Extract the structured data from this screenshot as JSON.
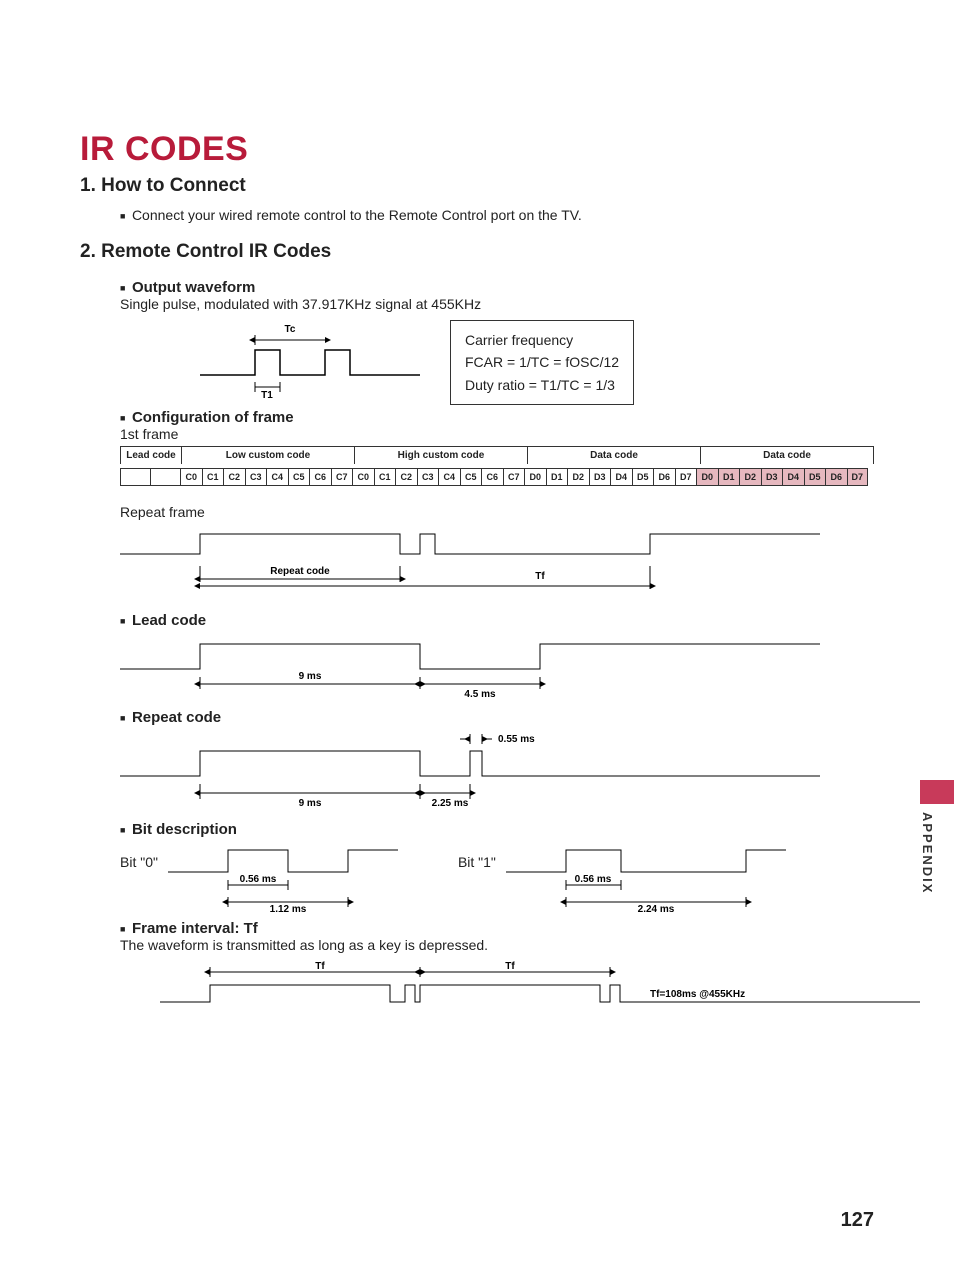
{
  "title": "IR CODES",
  "sections": {
    "connect": {
      "heading": "1. How to Connect",
      "text": "Connect your wired remote control to the Remote Control port on the TV."
    },
    "remote": {
      "heading": "2. Remote Control IR Codes",
      "output_waveform": {
        "heading": "Output waveform",
        "text": "Single pulse, modulated with 37.917KHz signal at 455KHz",
        "tc": "Tc",
        "t1": "T1",
        "carrier": {
          "line1": "Carrier frequency",
          "line2": "FCAR = 1/TC = fOSC/12",
          "line3": "Duty ratio = T1/TC = 1/3"
        }
      },
      "config": {
        "heading": "Configuration of frame",
        "first_frame": "1st frame",
        "headers": [
          "Lead code",
          "Low custom code",
          "High custom code",
          "Data code",
          "Data code"
        ],
        "low_bits": [
          "C0",
          "C1",
          "C2",
          "C3",
          "C4",
          "C5",
          "C6",
          "C7"
        ],
        "high_bits": [
          "C0",
          "C1",
          "C2",
          "C3",
          "C4",
          "C5",
          "C6",
          "C7"
        ],
        "data_bits": [
          "D0",
          "D1",
          "D2",
          "D3",
          "D4",
          "D5",
          "D6",
          "D7"
        ],
        "data_bits2": [
          "D0",
          "D1",
          "D2",
          "D3",
          "D4",
          "D5",
          "D6",
          "D7"
        ],
        "repeat_frame": "Repeat frame",
        "repeat_code": "Repeat  code",
        "tf": "Tf"
      },
      "lead_code": {
        "heading": "Lead code",
        "t9": "9 ms",
        "t45": "4.5 ms"
      },
      "repeat_code": {
        "heading": "Repeat code",
        "t9": "9 ms",
        "t225": "2.25 ms",
        "t055": "0.55 ms"
      },
      "bit_desc": {
        "heading": "Bit description",
        "bit0": "Bit \"0\"",
        "bit1": "Bit \"1\"",
        "t056": "0.56 ms",
        "t112": "1.12 ms",
        "t224": "2.24 ms"
      },
      "frame_interval": {
        "heading": "Frame interval: Tf",
        "text": "The waveform is transmitted as long as a key is depressed.",
        "tf": "Tf",
        "note": "Tf=108ms @455KHz"
      }
    }
  },
  "sidebar": "APPENDIX",
  "page_number": "127"
}
